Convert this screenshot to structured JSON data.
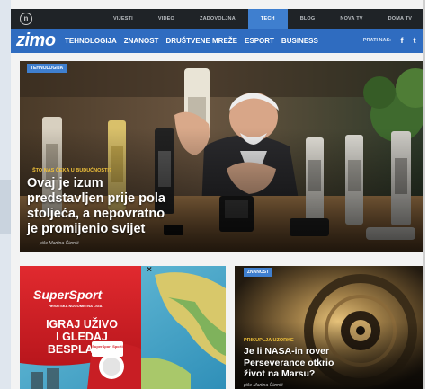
{
  "top_nav": {
    "logo_letter": "n",
    "items": [
      {
        "label": "VIJESTI",
        "active": false
      },
      {
        "label": "VIDEO",
        "active": false
      },
      {
        "label": "ZADOVOLJNA",
        "active": false
      },
      {
        "label": "TECH",
        "active": true
      },
      {
        "label": "BLOG",
        "active": false
      },
      {
        "label": "NOVA TV",
        "active": false
      },
      {
        "label": "DOMA TV",
        "active": false
      }
    ]
  },
  "main_nav": {
    "brand": "zimo",
    "categories": [
      "TEHNOLOGIJA",
      "ZNANOST",
      "DRUŠTVENE MREŽE",
      "ESPORT",
      "BUSINESS"
    ],
    "follow_label": "PRATI NAS:",
    "social_icons": [
      "facebook-icon",
      "twitter-icon"
    ]
  },
  "hero": {
    "tag": "TEHNOLOGIJA",
    "kicker": "ŠTO NAS ČEKA U BUDUĆNOSTI?",
    "headline": [
      "Ovaj je izum",
      "predstavljen prije pola",
      "stoljeća, a nepovratno",
      "je promijenio svijet"
    ],
    "byline": "piše Martina Čizmić"
  },
  "ad": {
    "brand": "SuperSport",
    "sub": "HRVATSKA NOGOMETNA LIGA",
    "lines": [
      "IGRAJ UŽIVO",
      "I GLEDAJ",
      "BESPLATNO"
    ],
    "badge": "SuperSport Sporti",
    "close_icon": "close-icon"
  },
  "card2": {
    "tag": "ZNANOST",
    "kicker": "PRIKUPLJA UZORKE",
    "headline": [
      "Je li NASA-in rover",
      "Perseverance otkrio",
      "život na Marsu?"
    ],
    "byline": "piše Martina Čizmić"
  },
  "colors": {
    "accent_blue": "#2f6cc0",
    "tag_blue": "#3f7fcf",
    "topbar": "#1f2327",
    "kicker_yellow": "#f0c23a",
    "ad_red": "#d8222b"
  }
}
